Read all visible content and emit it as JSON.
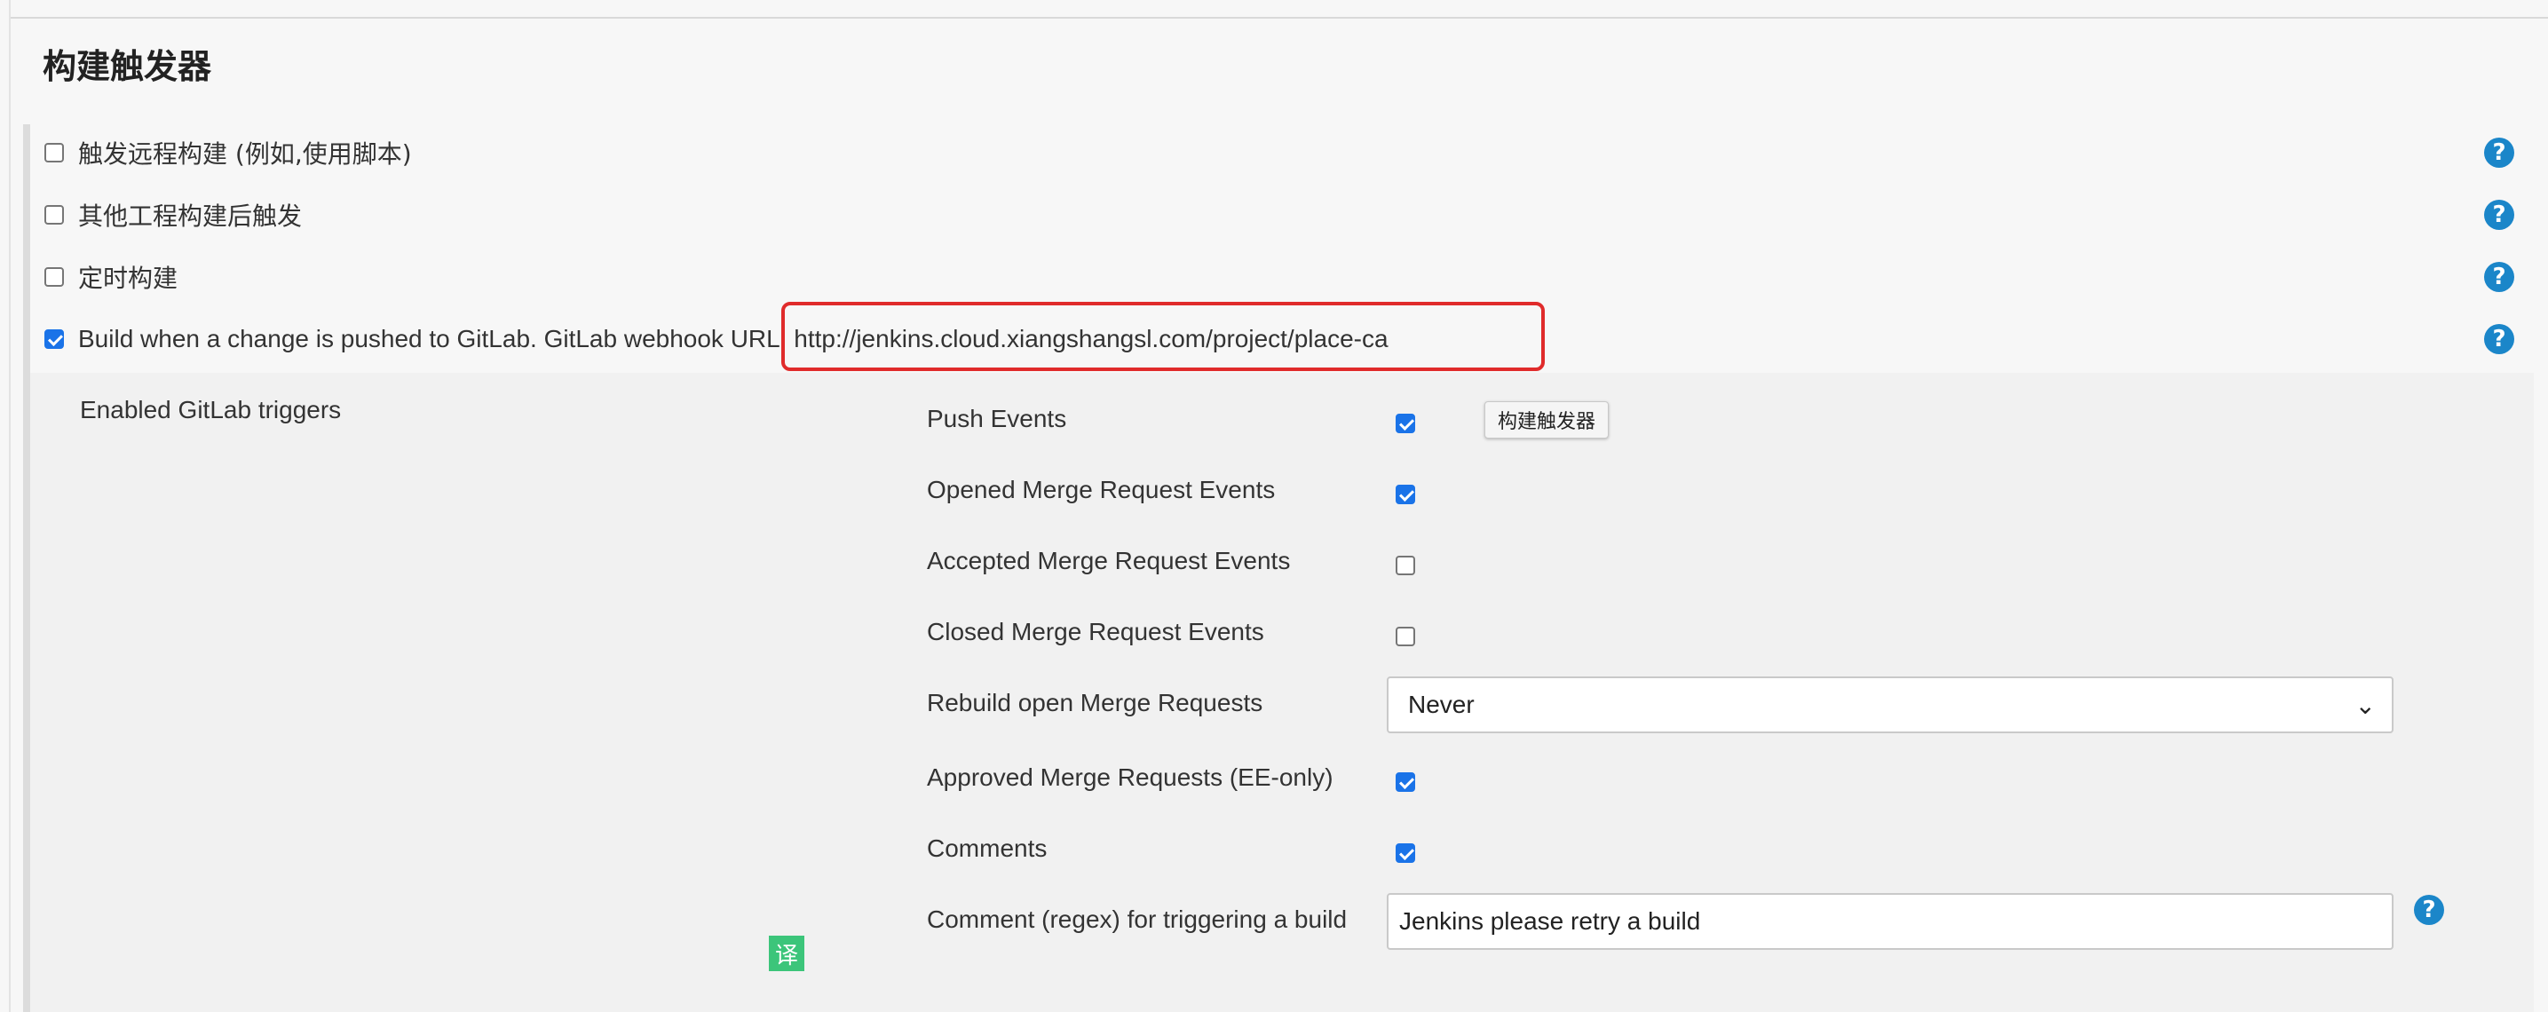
{
  "section": {
    "title": "构建触发器"
  },
  "triggers": [
    {
      "label": "触发远程构建 (例如,使用脚本)",
      "checked": false
    },
    {
      "label": "其他工程构建后触发",
      "checked": false
    },
    {
      "label": "定时构建",
      "checked": false
    },
    {
      "label": "Build when a change is pushed to GitLab. GitLab webhook URL: http://jenkins.cloud.xiangshangsl.com/project/place-ca",
      "checked": true
    }
  ],
  "gitlab": {
    "enabled_label": "Enabled GitLab triggers",
    "events": [
      {
        "label": "Push Events",
        "checked": true
      },
      {
        "label": "Opened Merge Request Events",
        "checked": true
      },
      {
        "label": "Accepted Merge Request Events",
        "checked": false
      },
      {
        "label": "Closed Merge Request Events",
        "checked": false
      }
    ],
    "rebuild": {
      "label": "Rebuild open Merge Requests",
      "value": "Never"
    },
    "approved": {
      "label": "Approved Merge Requests (EE-only)",
      "checked": true
    },
    "comments": {
      "label": "Comments",
      "checked": true
    },
    "comment_regex": {
      "label": "Comment (regex) for triggering a build",
      "value": "Jenkins please retry a build"
    }
  },
  "tooltip": {
    "text": "构建触发器"
  },
  "translate_badge": "译",
  "help_symbol": "?",
  "colors": {
    "accent": "#1a73e8",
    "help": "#1b86c9",
    "highlight": "#e02b2b",
    "badge": "#3cc57a"
  }
}
